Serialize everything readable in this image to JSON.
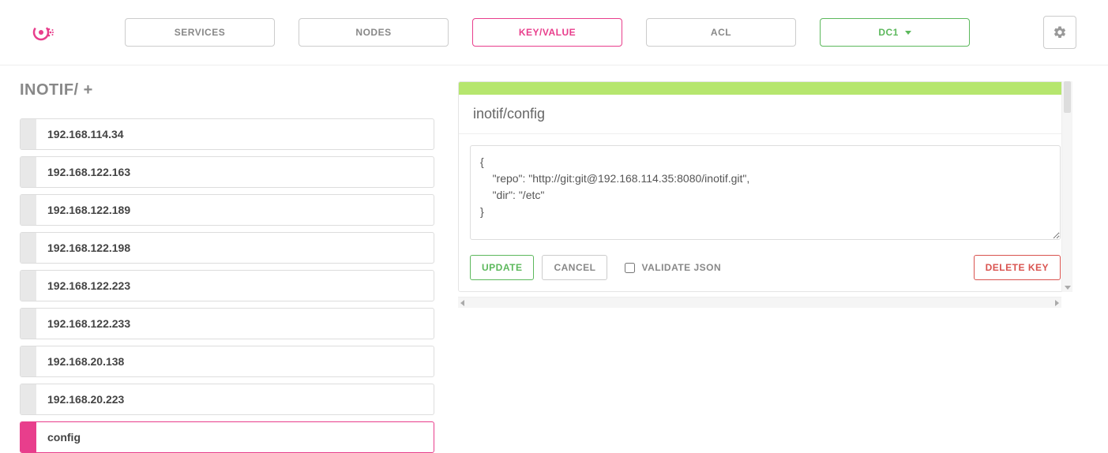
{
  "nav": {
    "services": "SERVICES",
    "nodes": "NODES",
    "keyvalue": "KEY/VALUE",
    "acl": "ACL",
    "dc": "DC1"
  },
  "breadcrumb": "INOTIF/ +",
  "keys": [
    {
      "label": "192.168.114.34"
    },
    {
      "label": "192.168.122.163"
    },
    {
      "label": "192.168.122.189"
    },
    {
      "label": "192.168.122.198"
    },
    {
      "label": "192.168.122.223"
    },
    {
      "label": "192.168.122.233"
    },
    {
      "label": "192.168.20.138"
    },
    {
      "label": "192.168.20.223"
    },
    {
      "label": "config"
    }
  ],
  "selected_index": 8,
  "editor": {
    "title": "inotif/config",
    "value": "{\n    \"repo\": \"http://git:git@192.168.114.35:8080/inotif.git\",\n    \"dir\": \"/etc\"\n}",
    "update_label": "UPDATE",
    "cancel_label": "CANCEL",
    "validate_label": "VALIDATE JSON",
    "delete_label": "DELETE KEY"
  },
  "colors": {
    "pink": "#e83e8c",
    "green": "#5cb85c",
    "red": "#d9534f",
    "status_green": "#b6e66e"
  }
}
